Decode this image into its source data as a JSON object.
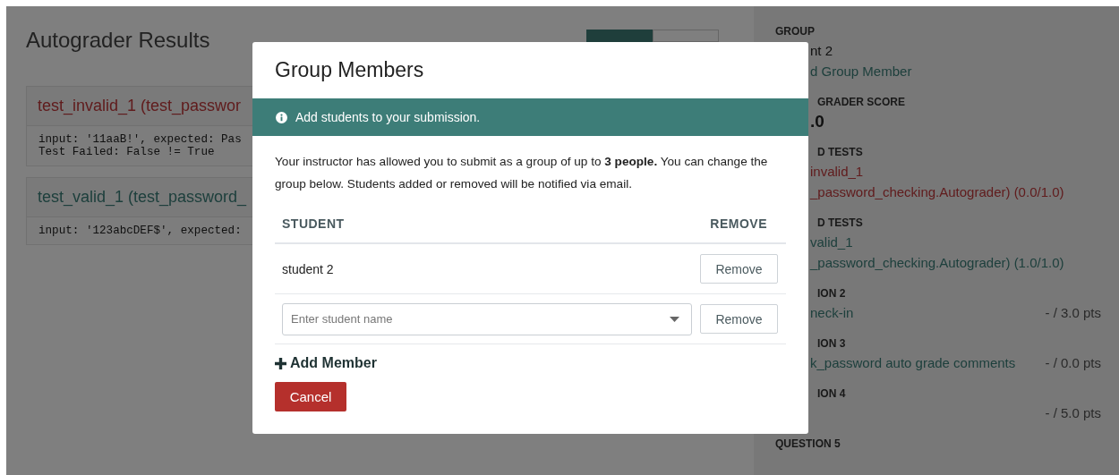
{
  "page": {
    "title": "Autograder Results",
    "tabs": [
      {
        "selected": true
      },
      {
        "selected": false
      }
    ],
    "tests": [
      {
        "name": "test_invalid_1 (test_passwor",
        "passed": false,
        "output": [
          "input: '11aaB!', expected: Pas",
          "Test Failed: False != True"
        ]
      },
      {
        "name": "test_valid_1 (test_password_",
        "passed": true,
        "output": [
          "input: '123abcDEF$', expected:"
        ]
      }
    ]
  },
  "sidebar": {
    "sections": [
      {
        "label": "GROUP",
        "label_covered": false,
        "lines": [
          {
            "text": "nt 2",
            "kind": "plain",
            "covered": true
          },
          {
            "text": "d Group Member",
            "kind": "link",
            "covered": true
          }
        ]
      },
      {
        "label": "GRADER SCORE",
        "label_covered": true,
        "lines": [
          {
            "text": ".0",
            "kind": "score",
            "covered": true
          }
        ]
      },
      {
        "label": "D TESTS",
        "label_covered": true,
        "lines": [
          {
            "text": "invalid_1",
            "kind": "failed",
            "covered": true
          },
          {
            "text": "_password_checking.Autograder) (0.0/1.0)",
            "kind": "failed",
            "covered": true
          }
        ]
      },
      {
        "label": "D TESTS",
        "label_covered": true,
        "lines": [
          {
            "text": "valid_1",
            "kind": "passed",
            "covered": true
          },
          {
            "text": "_password_checking.Autograder) (1.0/1.0)",
            "kind": "passed",
            "covered": true
          }
        ]
      },
      {
        "label": "ION 2",
        "label_covered": true,
        "lines": [
          {
            "text": "neck-in",
            "kind": "link",
            "covered": true,
            "points": "- / 3.0 pts"
          }
        ]
      },
      {
        "label": "ION 3",
        "label_covered": true,
        "lines": [
          {
            "text": "k_password auto grade comments",
            "kind": "link",
            "covered": true,
            "points": "- / 0.0 pts"
          }
        ]
      },
      {
        "label": "ION 4",
        "label_covered": true,
        "lines": [
          {
            "points": "- / 5.0 pts"
          }
        ]
      },
      {
        "label": "QUESTION 5",
        "label_covered": false
      }
    ]
  },
  "modal": {
    "title": "Group Members",
    "notice": "Add students to your submission.",
    "message": "Your instructor has allowed you to submit as a group of up to **3 people.** You can change the group below. Students added or removed will be notified via email.",
    "columns": [
      "STUDENT",
      "REMOVE"
    ],
    "members": [
      {
        "kind": "name",
        "name": "student 2",
        "action": "Remove"
      },
      {
        "kind": "picker",
        "placeholder": "Enter student name",
        "action": "Remove"
      }
    ],
    "add_member": "Add Member",
    "cancel": "Cancel"
  }
}
